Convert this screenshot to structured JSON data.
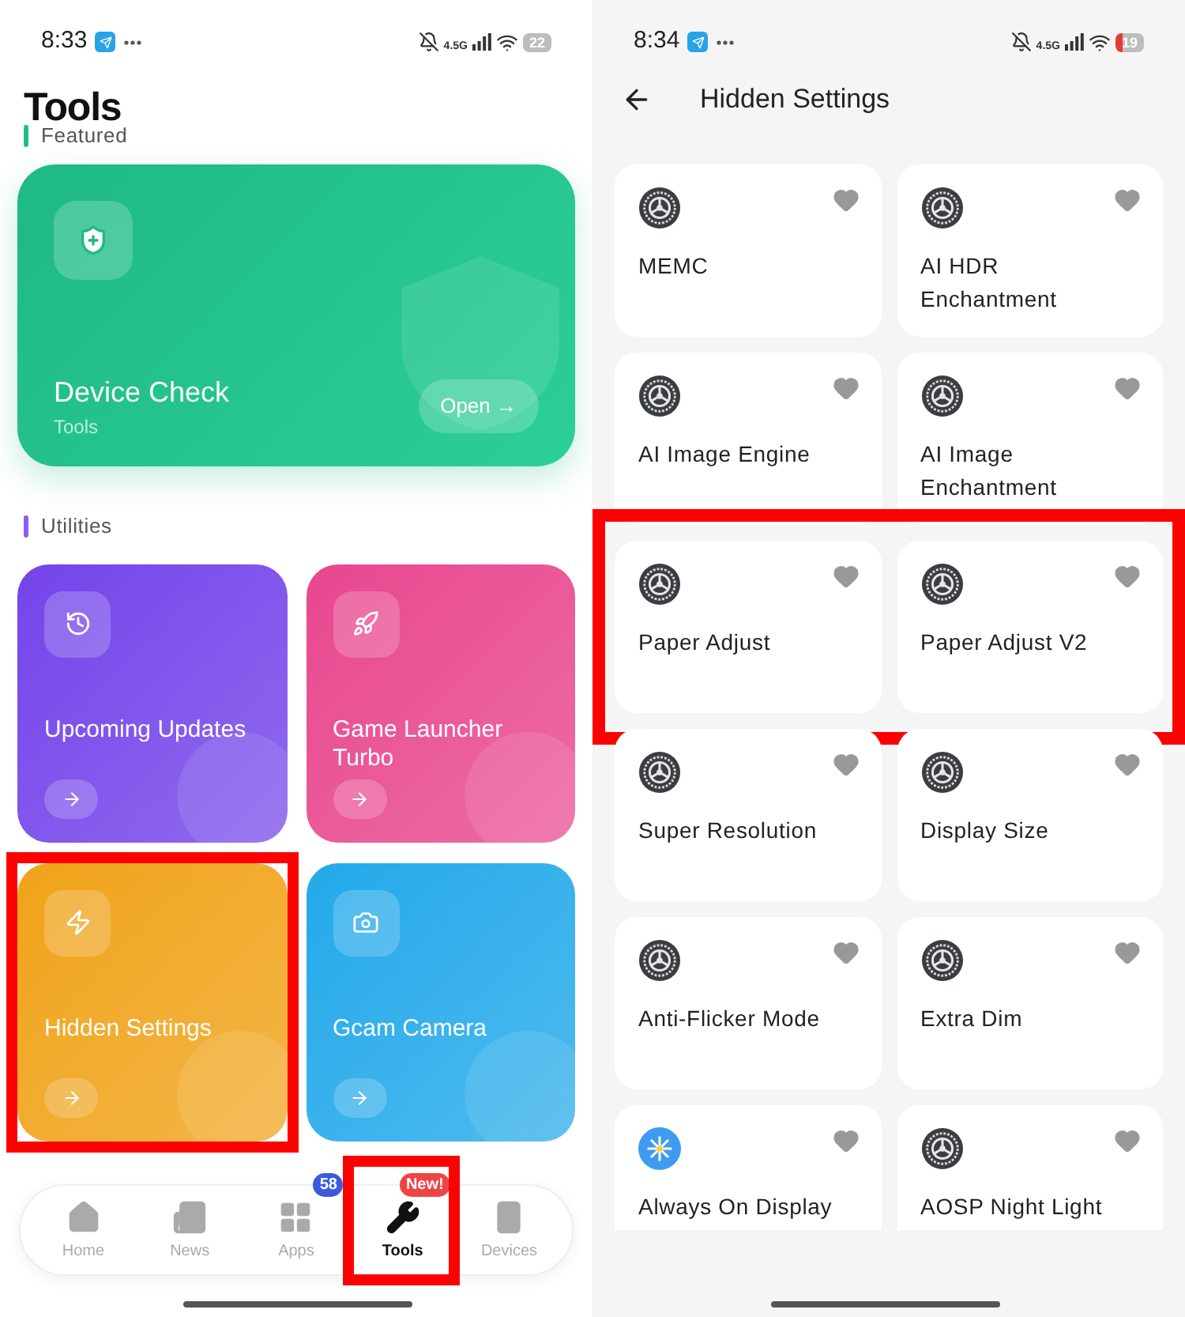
{
  "left": {
    "status_bar": {
      "time": "8:33",
      "network": "4.5G",
      "battery": "22",
      "battery_low": false
    },
    "title": "Tools",
    "featured": {
      "label": "Featured",
      "card": {
        "title": "Device Check",
        "subtitle": "Tools",
        "button": "Open →"
      }
    },
    "utilities": {
      "label": "Utilities",
      "cards": [
        {
          "title": "Upcoming Updates",
          "color": "#7444ea",
          "highlighted": false
        },
        {
          "title": "Game Launcher Turbo",
          "color": "#e8478f",
          "highlighted": false
        },
        {
          "title": "Hidden Settings",
          "color": "#f0a31a",
          "highlighted": true
        },
        {
          "title": "Gcam Camera",
          "color": "#23a9ea",
          "highlighted": false
        }
      ]
    },
    "nav": [
      {
        "label": "Home",
        "selected": false,
        "highlighted": false
      },
      {
        "label": "News",
        "selected": false,
        "highlighted": false
      },
      {
        "label": "Apps",
        "selected": false,
        "badge": "58",
        "highlighted": false
      },
      {
        "label": "Tools",
        "selected": true,
        "badge": "New!",
        "highlighted": true
      },
      {
        "label": "Devices",
        "selected": false,
        "highlighted": false
      }
    ]
  },
  "right": {
    "status_bar": {
      "time": "8:34",
      "network": "4.5G",
      "battery": "19",
      "battery_low": true
    },
    "title": "Hidden Settings",
    "rows": [
      {
        "highlighted": false,
        "items": [
          {
            "name": "MEMC",
            "kind": "gear"
          },
          {
            "name": "AI HDR Enchantment",
            "kind": "gear"
          }
        ]
      },
      {
        "highlighted": false,
        "items": [
          {
            "name": "AI Image Engine",
            "kind": "gear"
          },
          {
            "name": "AI Image Enchantment",
            "kind": "gear"
          }
        ]
      },
      {
        "highlighted": true,
        "items": [
          {
            "name": "Paper Adjust",
            "kind": "gear"
          },
          {
            "name": "Paper Adjust V2",
            "kind": "gear"
          }
        ]
      },
      {
        "highlighted": false,
        "items": [
          {
            "name": "Super Resolution",
            "kind": "gear"
          },
          {
            "name": "Display Size",
            "kind": "gear"
          }
        ]
      },
      {
        "highlighted": false,
        "items": [
          {
            "name": "Anti-Flicker Mode",
            "kind": "gear"
          },
          {
            "name": "Extra Dim",
            "kind": "gear"
          }
        ]
      },
      {
        "highlighted": false,
        "items": [
          {
            "name": "Always On Display",
            "kind": "sun"
          },
          {
            "name": "AOSP Night Light",
            "kind": "gear"
          }
        ]
      }
    ]
  }
}
